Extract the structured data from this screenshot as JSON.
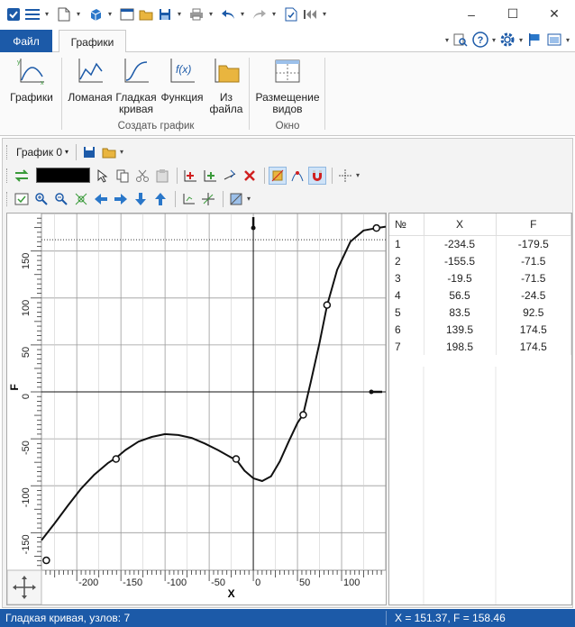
{
  "window": {
    "controls": [
      "–",
      "☐",
      "✕"
    ]
  },
  "ribbon": {
    "tabs": [
      {
        "label": "Файл"
      },
      {
        "label": "Графики"
      }
    ],
    "buttons": {
      "graphs": "Графики",
      "polyline": "Ломаная",
      "smooth_curve": "Гладкая кривая",
      "function": "Функция",
      "from_file": "Из файла",
      "view_layout": "Размещение видов"
    },
    "groups": {
      "create_graph": "Создать график",
      "window": "Окно"
    }
  },
  "toolbar": {
    "graph_selector": "График 0"
  },
  "chart_data": {
    "type": "line",
    "xlabel": "X",
    "ylabel": "F",
    "xlim": [
      -240,
      150
    ],
    "ylim": [
      -190,
      190
    ],
    "x_ticks": [
      -200,
      -150,
      -100,
      -50,
      0,
      50,
      100
    ],
    "y_ticks": [
      -150,
      -100,
      -50,
      0,
      50,
      100,
      150
    ],
    "grid": true,
    "marker_line_y": 162,
    "points": {
      "x": [
        -234.5,
        -155.5,
        -19.5,
        56.5,
        83.5,
        139.5,
        198.5
      ],
      "y": [
        -179.5,
        -71.5,
        -71.5,
        -24.5,
        92.5,
        174.5,
        174.5
      ]
    },
    "curve": {
      "x": [
        -240,
        -225,
        -210,
        -195,
        -180,
        -165,
        -155,
        -145,
        -130,
        -115,
        -100,
        -85,
        -70,
        -55,
        -40,
        -25,
        -19.5,
        -10,
        0,
        10,
        20,
        30,
        40,
        50,
        56.5,
        65,
        75,
        83.5,
        95,
        110,
        125,
        139.5,
        150
      ],
      "y": [
        -158,
        -140,
        -121,
        -103,
        -88,
        -76,
        -70,
        -62,
        -53,
        -48,
        -45,
        -46,
        -49,
        -55,
        -62,
        -70,
        -72,
        -84,
        -92,
        -95,
        -90,
        -74,
        -53,
        -33,
        -24,
        10,
        52,
        92,
        130,
        160,
        172,
        174.5,
        176
      ]
    }
  },
  "table": {
    "headers": [
      "№",
      "X",
      "F"
    ],
    "rows": [
      [
        "1",
        "-234.5",
        "-179.5"
      ],
      [
        "2",
        "-155.5",
        "-71.5"
      ],
      [
        "3",
        "-19.5",
        "-71.5"
      ],
      [
        "4",
        "56.5",
        "-24.5"
      ],
      [
        "5",
        "83.5",
        "92.5"
      ],
      [
        "6",
        "139.5",
        "174.5"
      ],
      [
        "7",
        "198.5",
        "174.5"
      ]
    ]
  },
  "status": {
    "left": "Гладкая кривая, узлов: 7",
    "right": "X = 151.37, F = 158.46"
  },
  "colors": {
    "accent": "#1c5aa8"
  }
}
